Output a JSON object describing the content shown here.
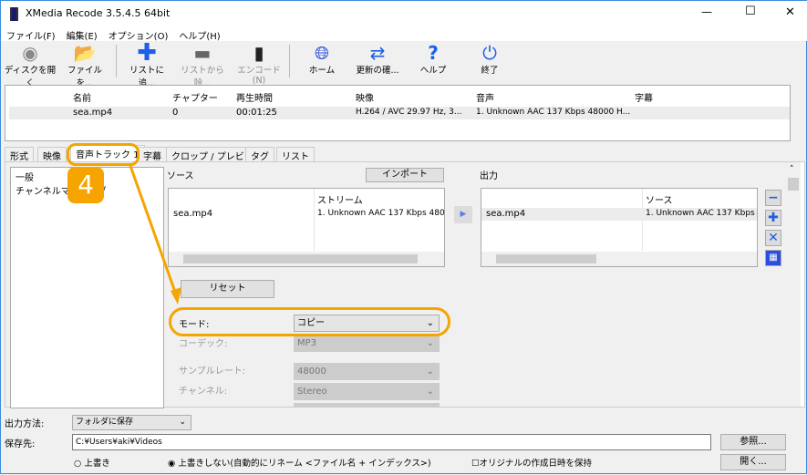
{
  "window": {
    "title": "XMedia Recode 3.5.4.5 64bit",
    "min": "—",
    "max": "☐",
    "close": "✕"
  },
  "menu": [
    "ファイル(F)",
    "編集(E)",
    "オプション(O)",
    "ヘルプ(H)"
  ],
  "toolbar": [
    {
      "label": "ディスクを開く",
      "icon": "disc-icon",
      "enabled": true
    },
    {
      "label": "ファイルを...",
      "icon": "folder-open-icon",
      "enabled": true
    },
    {
      "label": "リストに追...",
      "icon": "plus-icon",
      "enabled": true
    },
    {
      "label": "リストから除...",
      "icon": "minus-icon",
      "enabled": false
    },
    {
      "label": "エンコード(N)",
      "icon": "encode-icon",
      "enabled": false
    },
    {
      "label": "ホーム",
      "icon": "globe-icon",
      "enabled": true
    },
    {
      "label": "更新の確...",
      "icon": "refresh-icon",
      "enabled": true
    },
    {
      "label": "ヘルプ",
      "icon": "question-icon",
      "enabled": true
    },
    {
      "label": "終了",
      "icon": "power-icon",
      "enabled": true
    }
  ],
  "file_list": {
    "columns": [
      "",
      "名前",
      "チャプター",
      "再生時間",
      "映像",
      "音声",
      "字幕"
    ],
    "rows": [
      [
        "",
        "sea.mp4",
        "0",
        "00:01:25",
        "H.264 / AVC  29.97 Hz, 3...",
        "1. Unknown AAC  137 Kbps 48000 H...",
        ""
      ]
    ]
  },
  "tabs": [
    "形式",
    "映像",
    "音声トラック 1",
    "字幕",
    "クロップ / プレビュー",
    "タグ",
    "リスト"
  ],
  "active_tab": "音声トラック 1",
  "tree": [
    "一般",
    "チャンネルマッピング"
  ],
  "source": {
    "label": "ソース",
    "import": "インポート",
    "column": "ストリーム",
    "rows": [
      [
        "sea.mp4",
        "1. Unknown AAC  137 Kbps 480..."
      ]
    ]
  },
  "output": {
    "label": "出力",
    "column": "ソース",
    "rows": [
      [
        "sea.mp4",
        "1. Unknown AAC  137 Kbps 4"
      ]
    ]
  },
  "reset": "リセット",
  "settings": [
    {
      "label": "モード:",
      "value": "コピー",
      "enabled": true
    },
    {
      "label": "コーデック:",
      "value": "MP3",
      "enabled": false
    },
    {
      "label": "サンプルレート:",
      "value": "48000",
      "enabled": false
    },
    {
      "label": "チャンネル:",
      "value": "Stereo",
      "enabled": false
    }
  ],
  "bottom": {
    "method_label": "出力方法:",
    "method_value": "フォルダに保存",
    "dest_label": "保存先:",
    "dest_value": "C:¥Users¥aki¥Videos",
    "browse": "参照...",
    "open": "開く...",
    "overwrite": "上書き",
    "no_overwrite": "上書きしない(自動的にリネーム <ファイル名 + インデックス>)",
    "keep_date": "オリジナルの作成日時を保持"
  },
  "annotation": {
    "step": "4",
    "color": "#f5a400"
  }
}
